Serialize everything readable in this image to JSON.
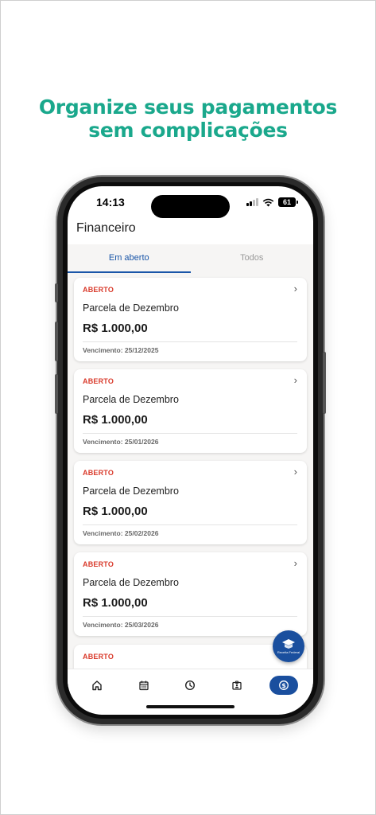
{
  "headline": {
    "line1": "Organize seus pagamentos",
    "line2": "sem complicações"
  },
  "status_bar": {
    "time": "14:13",
    "battery": "61"
  },
  "app": {
    "title": "Financeiro",
    "tabs": [
      {
        "label": "Em aberto",
        "active": true
      },
      {
        "label": "Todos",
        "active": false
      }
    ],
    "payments": [
      {
        "status": "ABERTO",
        "title": "Parcela de Dezembro",
        "amount": "R$ 1.000,00",
        "due": "Vencimento: 25/12/2025"
      },
      {
        "status": "ABERTO",
        "title": "Parcela de Dezembro",
        "amount": "R$ 1.000,00",
        "due": "Vencimento: 25/01/2026"
      },
      {
        "status": "ABERTO",
        "title": "Parcela de Dezembro",
        "amount": "R$ 1.000,00",
        "due": "Vencimento: 25/02/2026"
      },
      {
        "status": "ABERTO",
        "title": "Parcela de Dezembro",
        "amount": "R$ 1.000,00",
        "due": "Vencimento: 25/03/2026"
      },
      {
        "status": "ABERTO",
        "title": "",
        "amount": "",
        "due": ""
      }
    ],
    "fab": {
      "icon": "receita-federal-icon",
      "label": "Receita Federal"
    },
    "bottom_nav": [
      {
        "icon": "home-icon",
        "active": false
      },
      {
        "icon": "calendar-icon",
        "active": false
      },
      {
        "icon": "clock-icon",
        "active": false
      },
      {
        "icon": "id-card-icon",
        "active": false
      },
      {
        "icon": "dollar-icon",
        "active": true
      }
    ]
  },
  "colors": {
    "headline": "#1aa88c",
    "primary": "#1a4f9e",
    "tab_active": "#1a56a8",
    "status_open": "#d93a2b"
  }
}
